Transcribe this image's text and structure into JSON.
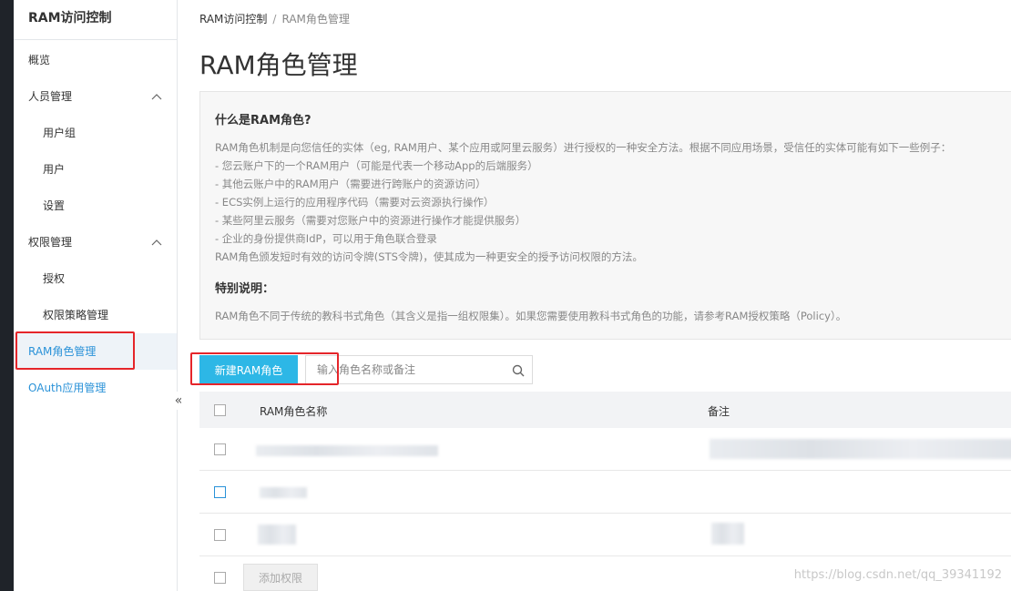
{
  "sidebar": {
    "title": "RAM访问控制",
    "items": {
      "overview": "概览",
      "people": "人员管理",
      "groups": "用户组",
      "users": "用户",
      "settings": "设置",
      "permissions": "权限管理",
      "authorize": "授权",
      "policies": "权限策略管理",
      "roles": "RAM角色管理",
      "oauth": "OAuth应用管理"
    },
    "collapse_icon": "«"
  },
  "breadcrumb": {
    "root": "RAM访问控制",
    "separator": "/",
    "current": "RAM角色管理"
  },
  "page_title": "RAM角色管理",
  "info": {
    "heading": "什么是RAM角色?",
    "lines": [
      "RAM角色机制是向您信任的实体（eg, RAM用户、某个应用或阿里云服务）进行授权的一种安全方法。根据不同应用场景，受信任的实体可能有如下一些例子：",
      "- 您云账户下的一个RAM用户（可能是代表一个移动App的后端服务）",
      "- 其他云账户中的RAM用户（需要进行跨账户的资源访问）",
      "- ECS实例上运行的应用程序代码（需要对云资源执行操作）",
      "- 某些阿里云服务（需要对您账户中的资源进行操作才能提供服务）",
      "- 企业的身份提供商IdP，可以用于角色联合登录",
      "RAM角色颁发短时有效的访问令牌(STS令牌)，使其成为一种更安全的授予访问权限的方法。"
    ],
    "special_heading": "特别说明：",
    "special_text": "RAM角色不同于传统的教科书式角色（其含义是指一组权限集）。如果您需要使用教科书式角色的功能，请参考RAM授权策略（Policy）。"
  },
  "toolbar": {
    "new_button": "新建RAM角色",
    "search_placeholder": "输入角色名称或备注"
  },
  "table": {
    "col_name": "RAM角色名称",
    "col_note": "备注",
    "add_permission": "添加权限"
  },
  "watermark": "https://blog.csdn.net/qq_39341192",
  "colors": {
    "accent": "#2db7e6",
    "link": "#2a92d8",
    "highlight": "#e5252a"
  }
}
